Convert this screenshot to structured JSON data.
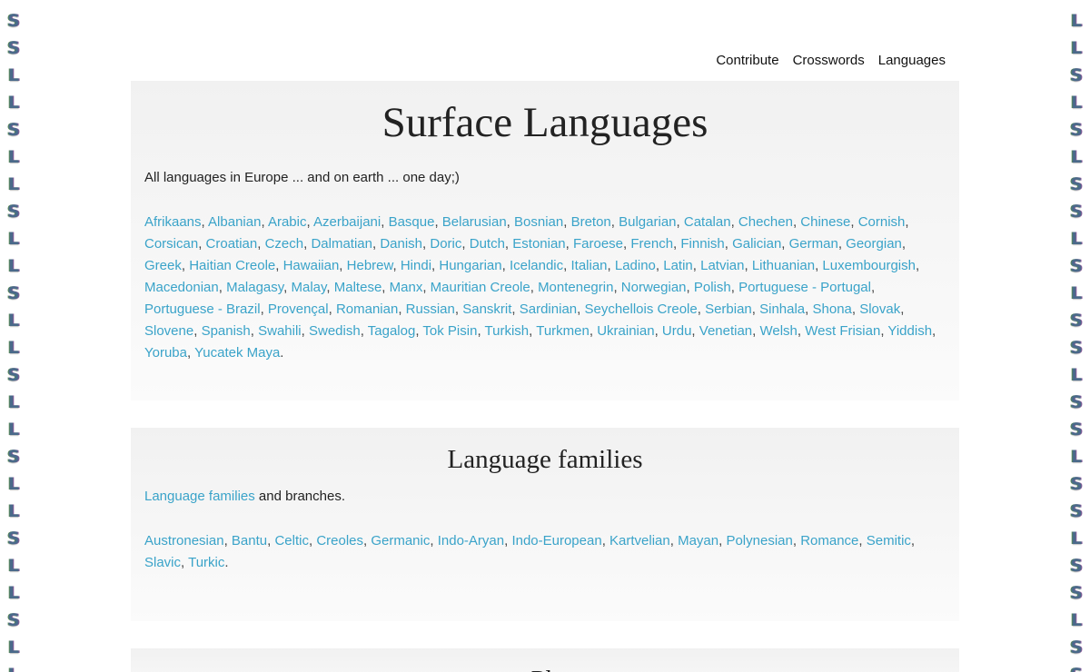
{
  "side_strips": {
    "left": [
      "S",
      "S",
      "L",
      "L",
      "S",
      "L",
      "L",
      "S",
      "L",
      "L",
      "S",
      "L",
      "L",
      "S",
      "L",
      "L",
      "S",
      "L",
      "L",
      "S",
      "L",
      "L",
      "S",
      "L",
      "L"
    ],
    "right": [
      "L",
      "L",
      "S",
      "L",
      "S",
      "L",
      "S",
      "S",
      "L",
      "S",
      "L",
      "S",
      "S",
      "L",
      "S",
      "S",
      "L",
      "S",
      "S",
      "L",
      "S",
      "S",
      "L",
      "S",
      "S"
    ]
  },
  "nav": {
    "items": [
      "Contribute",
      "Crosswords",
      "Languages"
    ]
  },
  "main": {
    "title": "Surface Languages",
    "intro": "All languages in Europe ... and on earth ... one day;)",
    "languages": [
      "Afrikaans",
      "Albanian",
      "Arabic",
      "Azerbaijani",
      "Basque",
      "Belarusian",
      "Bosnian",
      "Breton",
      "Bulgarian",
      "Catalan",
      "Chechen",
      "Chinese",
      "Cornish",
      "Corsican",
      "Croatian",
      "Czech",
      "Dalmatian",
      "Danish",
      "Doric",
      "Dutch",
      "Estonian",
      "Faroese",
      "French",
      "Finnish",
      "Galician",
      "German",
      "Georgian",
      "Greek",
      "Haitian Creole",
      "Hawaiian",
      "Hebrew",
      "Hindi",
      "Hungarian",
      "Icelandic",
      "Italian",
      "Ladino",
      "Latin",
      "Latvian",
      "Lithuanian",
      "Luxembourgish",
      "Macedonian",
      "Malagasy",
      "Malay",
      "Maltese",
      "Manx",
      "Mauritian Creole",
      "Montenegrin",
      "Norwegian",
      "Polish",
      "Portuguese - Portugal",
      "Portuguese - Brazil",
      "Provençal",
      "Romanian",
      "Russian",
      "Sanskrit",
      "Sardinian",
      "Seychellois Creole",
      "Serbian",
      "Sinhala",
      "Shona",
      "Slovak",
      "Slovene",
      "Spanish",
      "Swahili",
      "Swedish",
      "Tagalog",
      "Tok Pisin",
      "Turkish",
      "Turkmen",
      "Ukrainian",
      "Urdu",
      "Venetian",
      "Welsh",
      "West Frisian",
      "Yiddish",
      "Yoruba",
      "Yucatek Maya"
    ]
  },
  "families": {
    "title": "Language families",
    "intro_link": "Language families",
    "intro_rest": " and branches.",
    "items": [
      "Austronesian",
      "Bantu",
      "Celtic",
      "Creoles",
      "Germanic",
      "Indo-Aryan",
      "Indo-European",
      "Kartvelian",
      "Mayan",
      "Polynesian",
      "Romance",
      "Semitic",
      "Slavic",
      "Turkic"
    ]
  },
  "next_section": {
    "title_partial": "Ph"
  },
  "colors": {
    "link": "#3aa3c9",
    "panel_bg": "#f1f1f1",
    "text": "#222222"
  }
}
